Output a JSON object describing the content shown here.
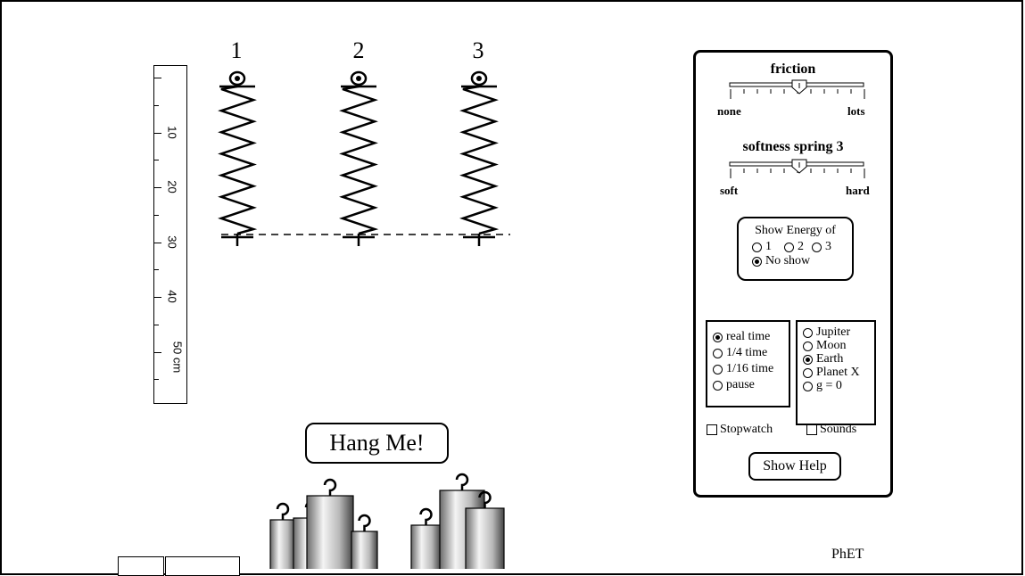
{
  "springs": {
    "labels": [
      "1",
      "2",
      "3"
    ]
  },
  "ruler": {
    "labels": [
      "10",
      "20",
      "30",
      "40",
      "50 cm"
    ]
  },
  "hang_me": "Hang Me!",
  "panel": {
    "friction": {
      "title": "friction",
      "min_label": "none",
      "max_label": "lots"
    },
    "softness": {
      "title": "softness spring 3",
      "min_label": "soft",
      "max_label": "hard"
    },
    "energy": {
      "title": "Show Energy of",
      "options": [
        "1",
        "2",
        "3",
        "No show"
      ],
      "selected": "No show"
    },
    "time": {
      "options": [
        "real time",
        "1/4 time",
        "1/16 time",
        "pause"
      ],
      "selected": "real time"
    },
    "planet": {
      "options": [
        "Jupiter",
        "Moon",
        "Earth",
        "Planet X",
        "g = 0"
      ],
      "selected": "Earth"
    },
    "stopwatch_label": "Stopwatch",
    "sounds_label": "Sounds",
    "help_label": "Show Help"
  },
  "brand": "PhET"
}
